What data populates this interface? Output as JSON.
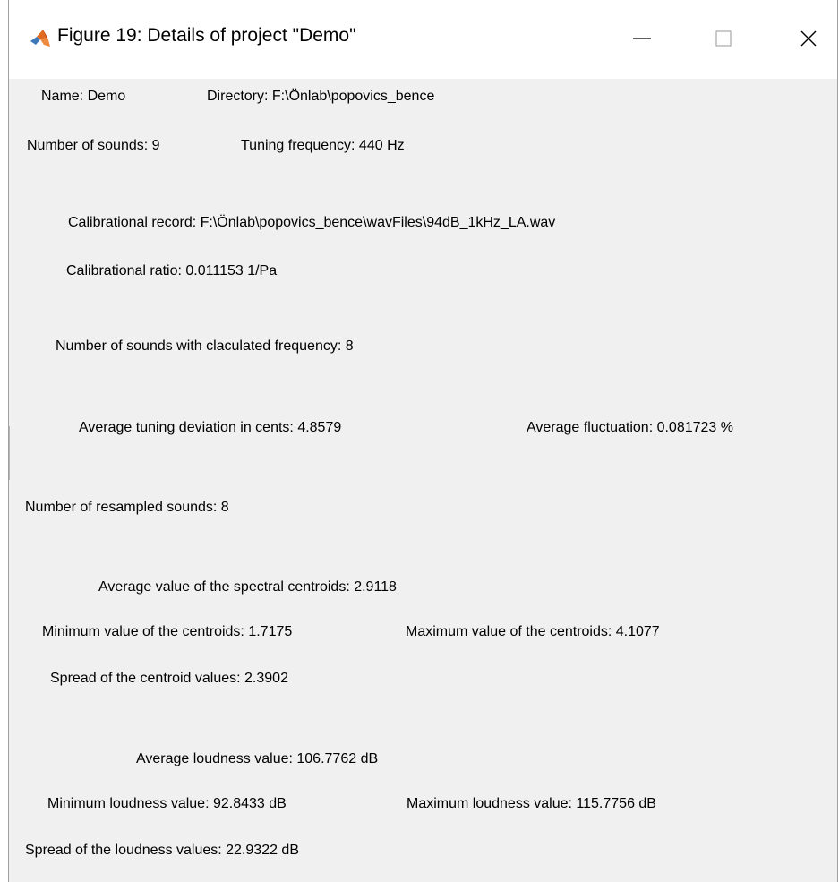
{
  "window": {
    "title": "Figure 19: Details of project \"Demo\"",
    "app_icon": "matlab-logo-icon",
    "controls": {
      "minimize": "minimize-icon",
      "maximize": "maximize-icon",
      "close": "close-icon"
    }
  },
  "details": {
    "name": "Name: Demo",
    "directory": "Directory: F:\\Önlab\\popovics_bence",
    "number_of_sounds": "Number of sounds: 9",
    "tuning_frequency": "Tuning frequency: 440 Hz",
    "calibrational_record": "Calibrational record: F:\\Önlab\\popovics_bence\\wavFiles\\94dB_1kHz_LA.wav",
    "calibrational_ratio": "Calibrational ratio: 0.011153 1/Pa",
    "sounds_with_frequency": "Number of sounds with claculated frequency: 8",
    "avg_tuning_deviation": "Average tuning deviation in cents: 4.8579",
    "avg_fluctuation": "Average fluctuation: 0.081723 %",
    "resampled_sounds": "Number of resampled sounds: 8",
    "avg_spectral_centroid": "Average value of the spectral centroids: 2.9118",
    "min_centroid": "Minimum value of the centroids: 1.7175",
    "max_centroid": "Maximum value of the centroids: 4.1077",
    "spread_centroid": "Spread of the centroid values: 2.3902",
    "avg_loudness": "Average loudness value: 106.7762 dB",
    "min_loudness": "Minimum loudness value: 92.8433 dB",
    "max_loudness": "Maximum loudness value: 115.7756 dB",
    "spread_loudness": "Spread of the loudness values: 22.9322 dB"
  }
}
